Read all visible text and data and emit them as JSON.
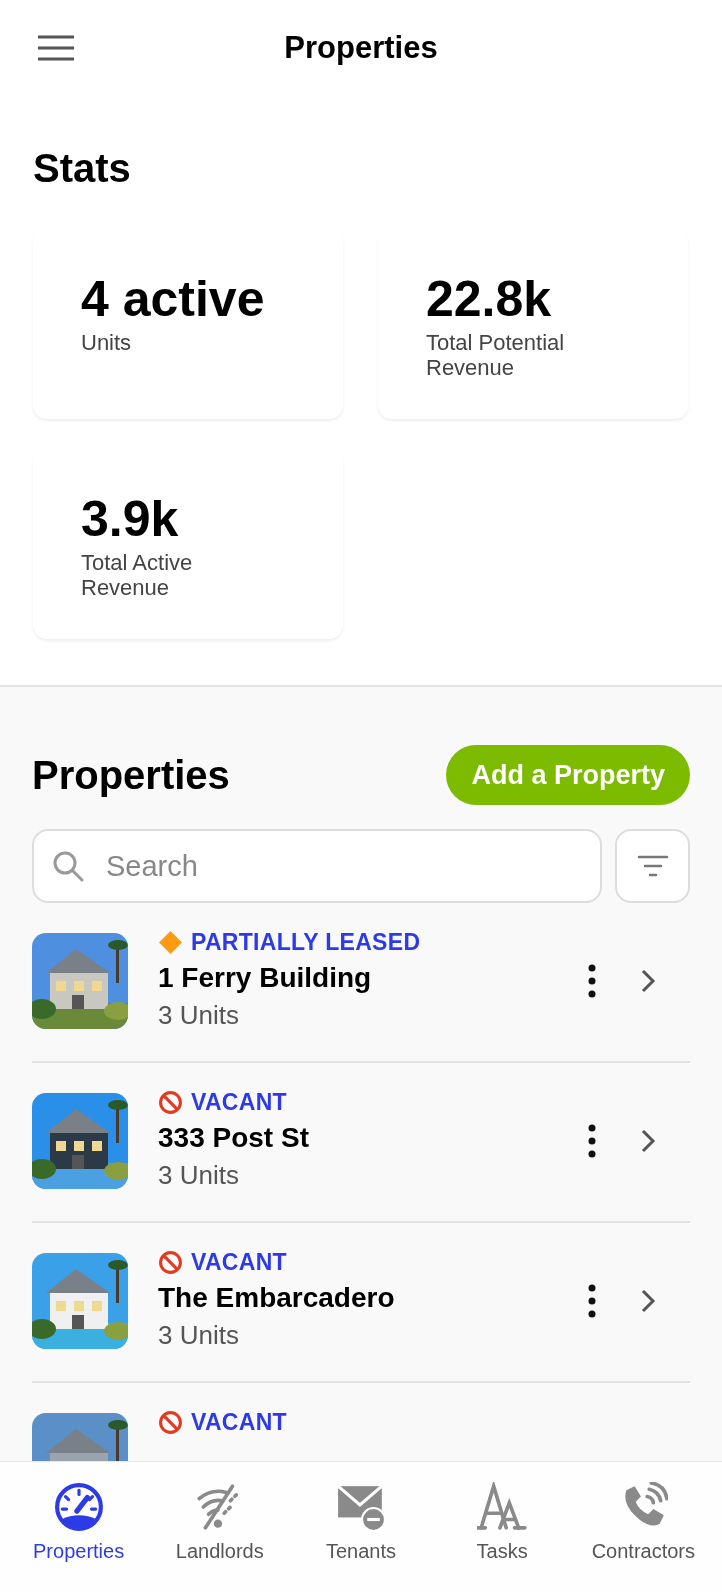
{
  "header": {
    "title": "Properties"
  },
  "stats": {
    "heading": "Stats",
    "cards": [
      {
        "value": "4 active",
        "label": "Units"
      },
      {
        "value": "22.8k",
        "label": "Total Potential Revenue"
      },
      {
        "value": "3.9k",
        "label": "Total Active Revenue"
      }
    ]
  },
  "properties": {
    "heading": "Properties",
    "add_button": "Add a Property",
    "search": {
      "placeholder": "Search"
    },
    "items": [
      {
        "kind": "partial",
        "status": "PARTIALLY LEASED",
        "name": "1 Ferry Building",
        "units": "3 Units"
      },
      {
        "kind": "vacant",
        "status": "VACANT",
        "name": "333 Post St",
        "units": "3 Units"
      },
      {
        "kind": "vacant",
        "status": "VACANT",
        "name": "The Embarcadero",
        "units": "3 Units"
      },
      {
        "kind": "vacant",
        "status": "VACANT"
      }
    ]
  },
  "nav": [
    {
      "kind": "gauge",
      "label": "Properties",
      "selected": true
    },
    {
      "kind": "signal",
      "label": "Landlords",
      "selected": false
    },
    {
      "kind": "mail",
      "label": "Tenants",
      "selected": false
    },
    {
      "kind": "letters",
      "label": "Tasks",
      "selected": false
    },
    {
      "kind": "phone",
      "label": "Contractors",
      "selected": false
    }
  ]
}
